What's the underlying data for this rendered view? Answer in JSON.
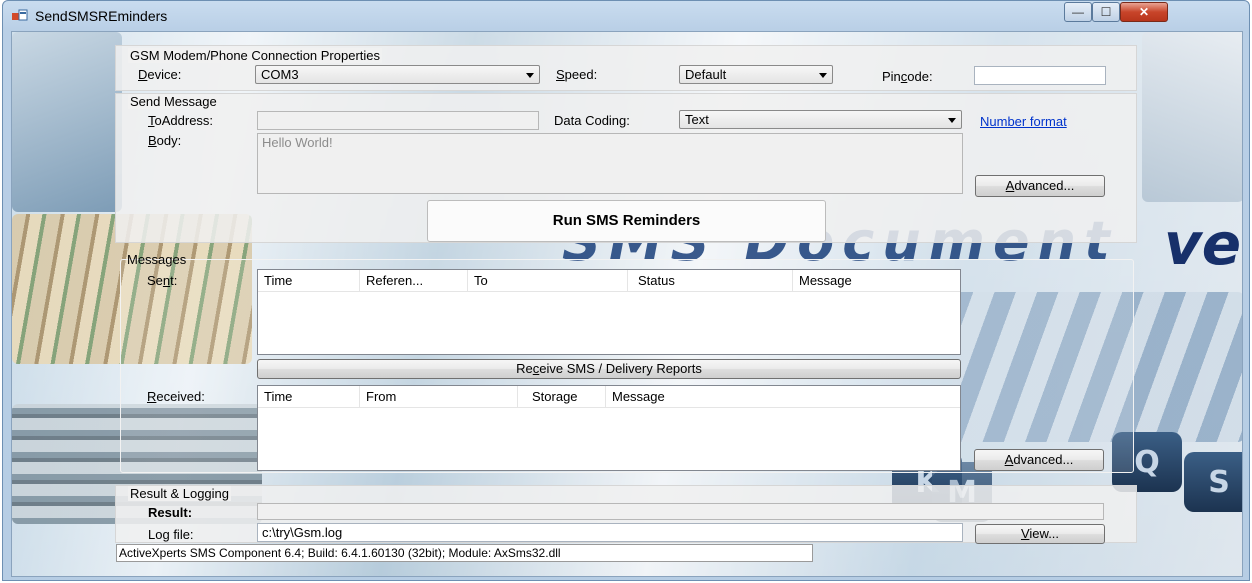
{
  "window": {
    "title": "SendSMSREminders",
    "controls": {
      "minimize": "—",
      "maximize": "☐",
      "close": "✕"
    }
  },
  "background": {
    "big_text": "SMS Document",
    "tail_text": "ve",
    "keys": [
      "K",
      "M",
      "Q",
      "S"
    ]
  },
  "connection": {
    "group_label": "GSM Modem/Phone Connection Properties",
    "device_label_u": "D",
    "device_label_rest": "evice:",
    "device_value": "COM3",
    "speed_label_u": "S",
    "speed_label_rest": "peed:",
    "speed_value": "Default",
    "pincode_label_pre": "Pin",
    "pincode_label_u": "c",
    "pincode_label_post": "ode:",
    "pincode_value": ""
  },
  "send": {
    "group_label": "Send Message",
    "to_label_u": "T",
    "to_label_rest": "oAddress:",
    "to_value": "",
    "coding_label": "Data Coding:",
    "coding_value": "Text",
    "number_format_link": "Number format",
    "body_label_u": "B",
    "body_label_rest": "ody:",
    "body_value": "Hello World!",
    "advanced_u": "A",
    "advanced_rest": "dvanced...",
    "run_button": "Run SMS Reminders"
  },
  "messages": {
    "group_label": "Messages",
    "sent_label_pre": "Se",
    "sent_label_u": "n",
    "sent_label_post": "t:",
    "sent_columns": [
      "Time",
      "Referen...",
      "To",
      "Status",
      "Message"
    ],
    "receive_button_pre": "Re",
    "receive_button_u": "c",
    "receive_button_post": "eive SMS / Delivery Reports",
    "received_label_u": "R",
    "received_label_rest": "eceived:",
    "received_columns": [
      "Time",
      "From",
      "Storage",
      "Message"
    ],
    "advanced_u": "A",
    "advanced_rest": "dvanced..."
  },
  "result": {
    "group_label": "Result & Logging",
    "result_label": "Result:",
    "result_value": "",
    "logfile_label_pre": "Lo",
    "logfile_label_u": "g",
    "logfile_label_post": " file:",
    "logfile_value": "c:\\try\\Gsm.log",
    "view_u": "V",
    "view_rest": "iew..."
  },
  "status": {
    "text": "ActiveXperts SMS Component 6.4; Build: 6.4.1.60130 (32bit); Module: AxSms32.dll"
  }
}
